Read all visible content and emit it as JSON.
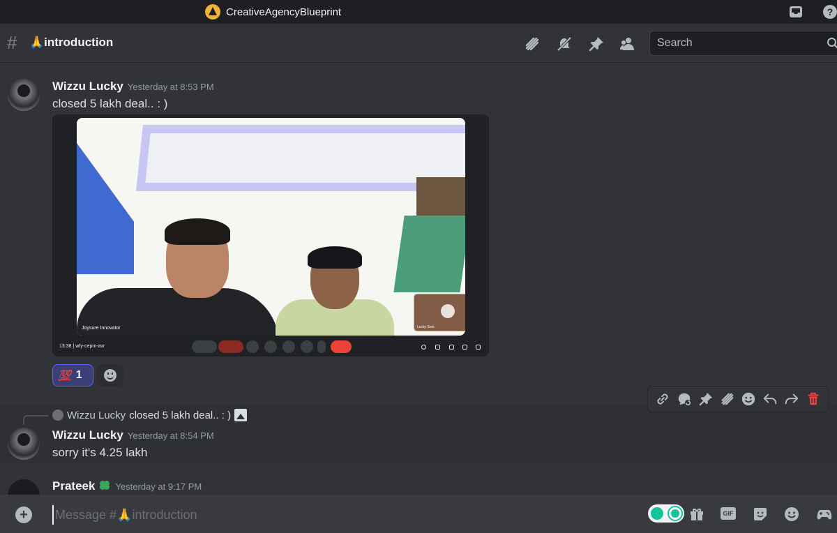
{
  "titlebar": {
    "server_name": "CreativeAgencyBlueprint",
    "icons": [
      "server-logo-icon",
      "inbox-icon",
      "help-icon"
    ],
    "help_glyph": "?"
  },
  "header": {
    "hash": "#",
    "channel_name": "🙏introduction",
    "icons": [
      "threads-icon",
      "notification-muted-icon",
      "pin-icon",
      "members-icon",
      "search-icon"
    ],
    "search_placeholder": "Search"
  },
  "messages": [
    {
      "author": "Wizzu Lucky",
      "timestamp": "Yesterday at 8:53 PM",
      "content": "closed 5 lakh deal.. : )",
      "attachment": {
        "video_label": "Joysure Innovator",
        "self_label": "Lucky Soni",
        "meet_time": "13:38",
        "meet_code": "wfy-cepm-avr"
      },
      "reactions": [
        {
          "emoji": "💯",
          "count": "1",
          "selected": true
        }
      ]
    },
    {
      "reply_to": {
        "author": "Wizzu Lucky",
        "text": "closed 5 lakh deal.. : )",
        "icon": "image-icon"
      },
      "author": "Wizzu Lucky",
      "timestamp": "Yesterday at 8:54 PM",
      "content": "sorry it's 4.25 lakh"
    },
    {
      "author": "Prateek",
      "badge_icon": "clover-icon",
      "timestamp": "Yesterday at 9:17 PM"
    }
  ],
  "message_toolbar": {
    "icons": [
      "copy-link-icon",
      "thread-reply-icon",
      "pin-icon",
      "threads-icon",
      "add-reaction-icon",
      "reply-icon",
      "forward-icon",
      "delete-icon"
    ]
  },
  "composer": {
    "placeholder": "Message #🙏introduction",
    "add_glyph": "+",
    "gif_label": "GIF",
    "icons": [
      "add-attachment-icon",
      "grammarly-icon",
      "gift-icon",
      "gif-icon",
      "sticker-icon",
      "emoji-icon",
      "activity-icon"
    ]
  },
  "colors": {
    "background": "#313338",
    "titlebar": "#1e1f22",
    "accent": "#5865f2",
    "delete_red": "#f23f43",
    "reaction_bg": "#3b3f78"
  }
}
